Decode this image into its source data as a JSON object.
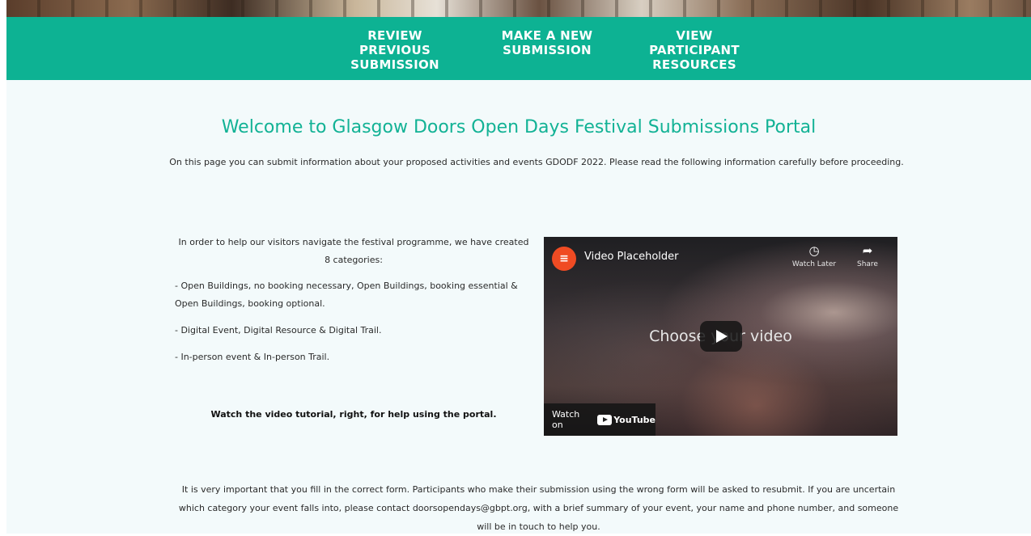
{
  "nav": {
    "items": [
      {
        "label": "REVIEW\nPREVIOUS\nSUBMISSION"
      },
      {
        "label": "MAKE A NEW\nSUBMISSION"
      },
      {
        "label": "VIEW\nPARTICIPANT\nRESOURCES"
      }
    ]
  },
  "main": {
    "title": "Welcome to Glasgow Doors Open Days Festival Submissions Portal",
    "intro": "On this page you can submit information about your proposed activities and events GDODF 2022. Please read the following information carefully before proceeding.",
    "categories_intro": "In order to help our visitors navigate the festival programme, we have created 8 categories:",
    "categories": [
      "- Open Buildings, no booking necessary, Open Buildings, booking essential & Open Buildings, booking optional.",
      "- Digital Event, Digital Resource & Digital Trail.",
      "- In-person event & In-person Trail."
    ],
    "watch_note": "Watch the video tutorial, right, for help using the portal.",
    "bottom_text": "It is very important that you fill in the correct form. Participants who make their submission using the wrong form will be asked to resubmit. If you are uncertain which category your event falls into, please contact doorsopendays@gbpt.org, with a brief summary of your event, your name and phone number, and someone will be in touch to help you."
  },
  "video": {
    "title": "Video Placeholder",
    "center_text": "Choose your video",
    "watch_later_label": "Watch Later",
    "share_label": "Share",
    "watch_on_label": "Watch on",
    "youtube_label": "YouTube",
    "logo_icon": "elementor-logo-icon",
    "play_icon": "play-icon"
  },
  "colors": {
    "accent": "#0db293",
    "title": "#12b295",
    "background": "#f3fafb"
  }
}
